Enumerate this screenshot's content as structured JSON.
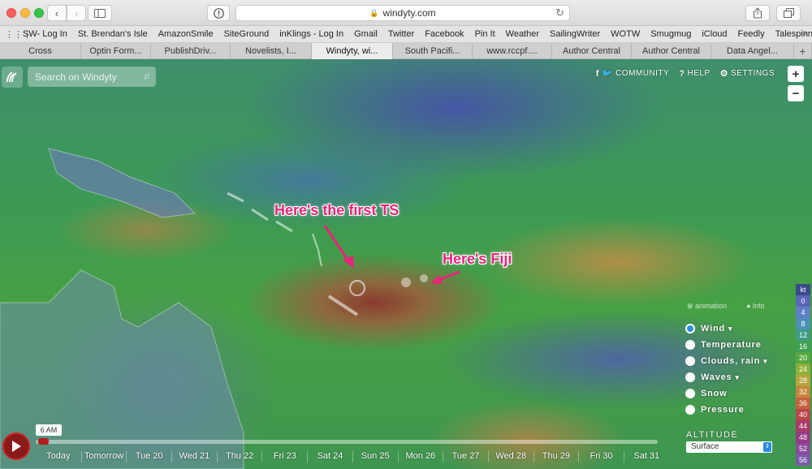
{
  "browser": {
    "url": "windyty.com",
    "bookmarks": [
      "SW- Log In",
      "St. Brendan's Isle",
      "AmazonSmile",
      "SiteGround",
      "inKlings - Log In",
      "Gmail",
      "Twitter",
      "Facebook",
      "Pin It",
      "Weather",
      "SailingWriter",
      "WOTW",
      "Smugmug",
      "iCloud",
      "Feedly",
      "Talespinner"
    ],
    "bookmarks_more": "»",
    "tabs": [
      "Cross",
      "Optin Form...",
      "PublishDriv...",
      "Novelists, I...",
      "Windyty, wi...",
      "South Pacifi...",
      "www.rccpf....",
      "Author Central",
      "Author Central",
      "Data Angel..."
    ],
    "active_tab_index": 4,
    "new_tab_symbol": "+"
  },
  "map": {
    "search_placeholder": "Search on Windyty",
    "menu": {
      "community": "COMMUNITY",
      "help": "HELP",
      "settings": "SETTINGS"
    },
    "zoom_in": "+",
    "zoom_out": "−",
    "annotations": {
      "ts": "Here's the first TS",
      "fiji": "Here's Fiji"
    },
    "accent_color": "#e8247a"
  },
  "overlay_toggles": [
    "animation",
    "info"
  ],
  "layers": [
    {
      "label": "Wind",
      "selected": true,
      "has_menu": true
    },
    {
      "label": "Temperature",
      "selected": false,
      "has_menu": false
    },
    {
      "label": "Clouds, rain",
      "selected": false,
      "has_menu": true
    },
    {
      "label": "Waves",
      "selected": false,
      "has_menu": true
    },
    {
      "label": "Snow",
      "selected": false,
      "has_menu": false
    },
    {
      "label": "Pressure",
      "selected": false,
      "has_menu": false
    }
  ],
  "altitude": {
    "label": "ALTITUDE",
    "value": "Surface"
  },
  "scale": {
    "unit": "kt",
    "values": [
      "0",
      "4",
      "8",
      "12",
      "16",
      "20",
      "24",
      "28",
      "32",
      "36",
      "40",
      "44",
      "48",
      "52",
      "56"
    ],
    "colors": [
      "#5a66b8",
      "#5d7fc4",
      "#4e8fb8",
      "#3f9a84",
      "#3fa050",
      "#55a840",
      "#8fb03a",
      "#b8a43c",
      "#c4863c",
      "#c4623e",
      "#b8464a",
      "#a83a6a",
      "#963a86",
      "#8a4a9a",
      "#7a5aa8"
    ]
  },
  "timeline": {
    "current_time": "6 AM",
    "days": [
      "Today",
      "Tomorrow",
      "Tue 20",
      "Wed 21",
      "Thu 22",
      "Fri 23",
      "Sat 24",
      "Sun 25",
      "Mon 26",
      "Tue 27",
      "Wed 28",
      "Thu 29",
      "Fri 30",
      "Sat 31"
    ]
  }
}
